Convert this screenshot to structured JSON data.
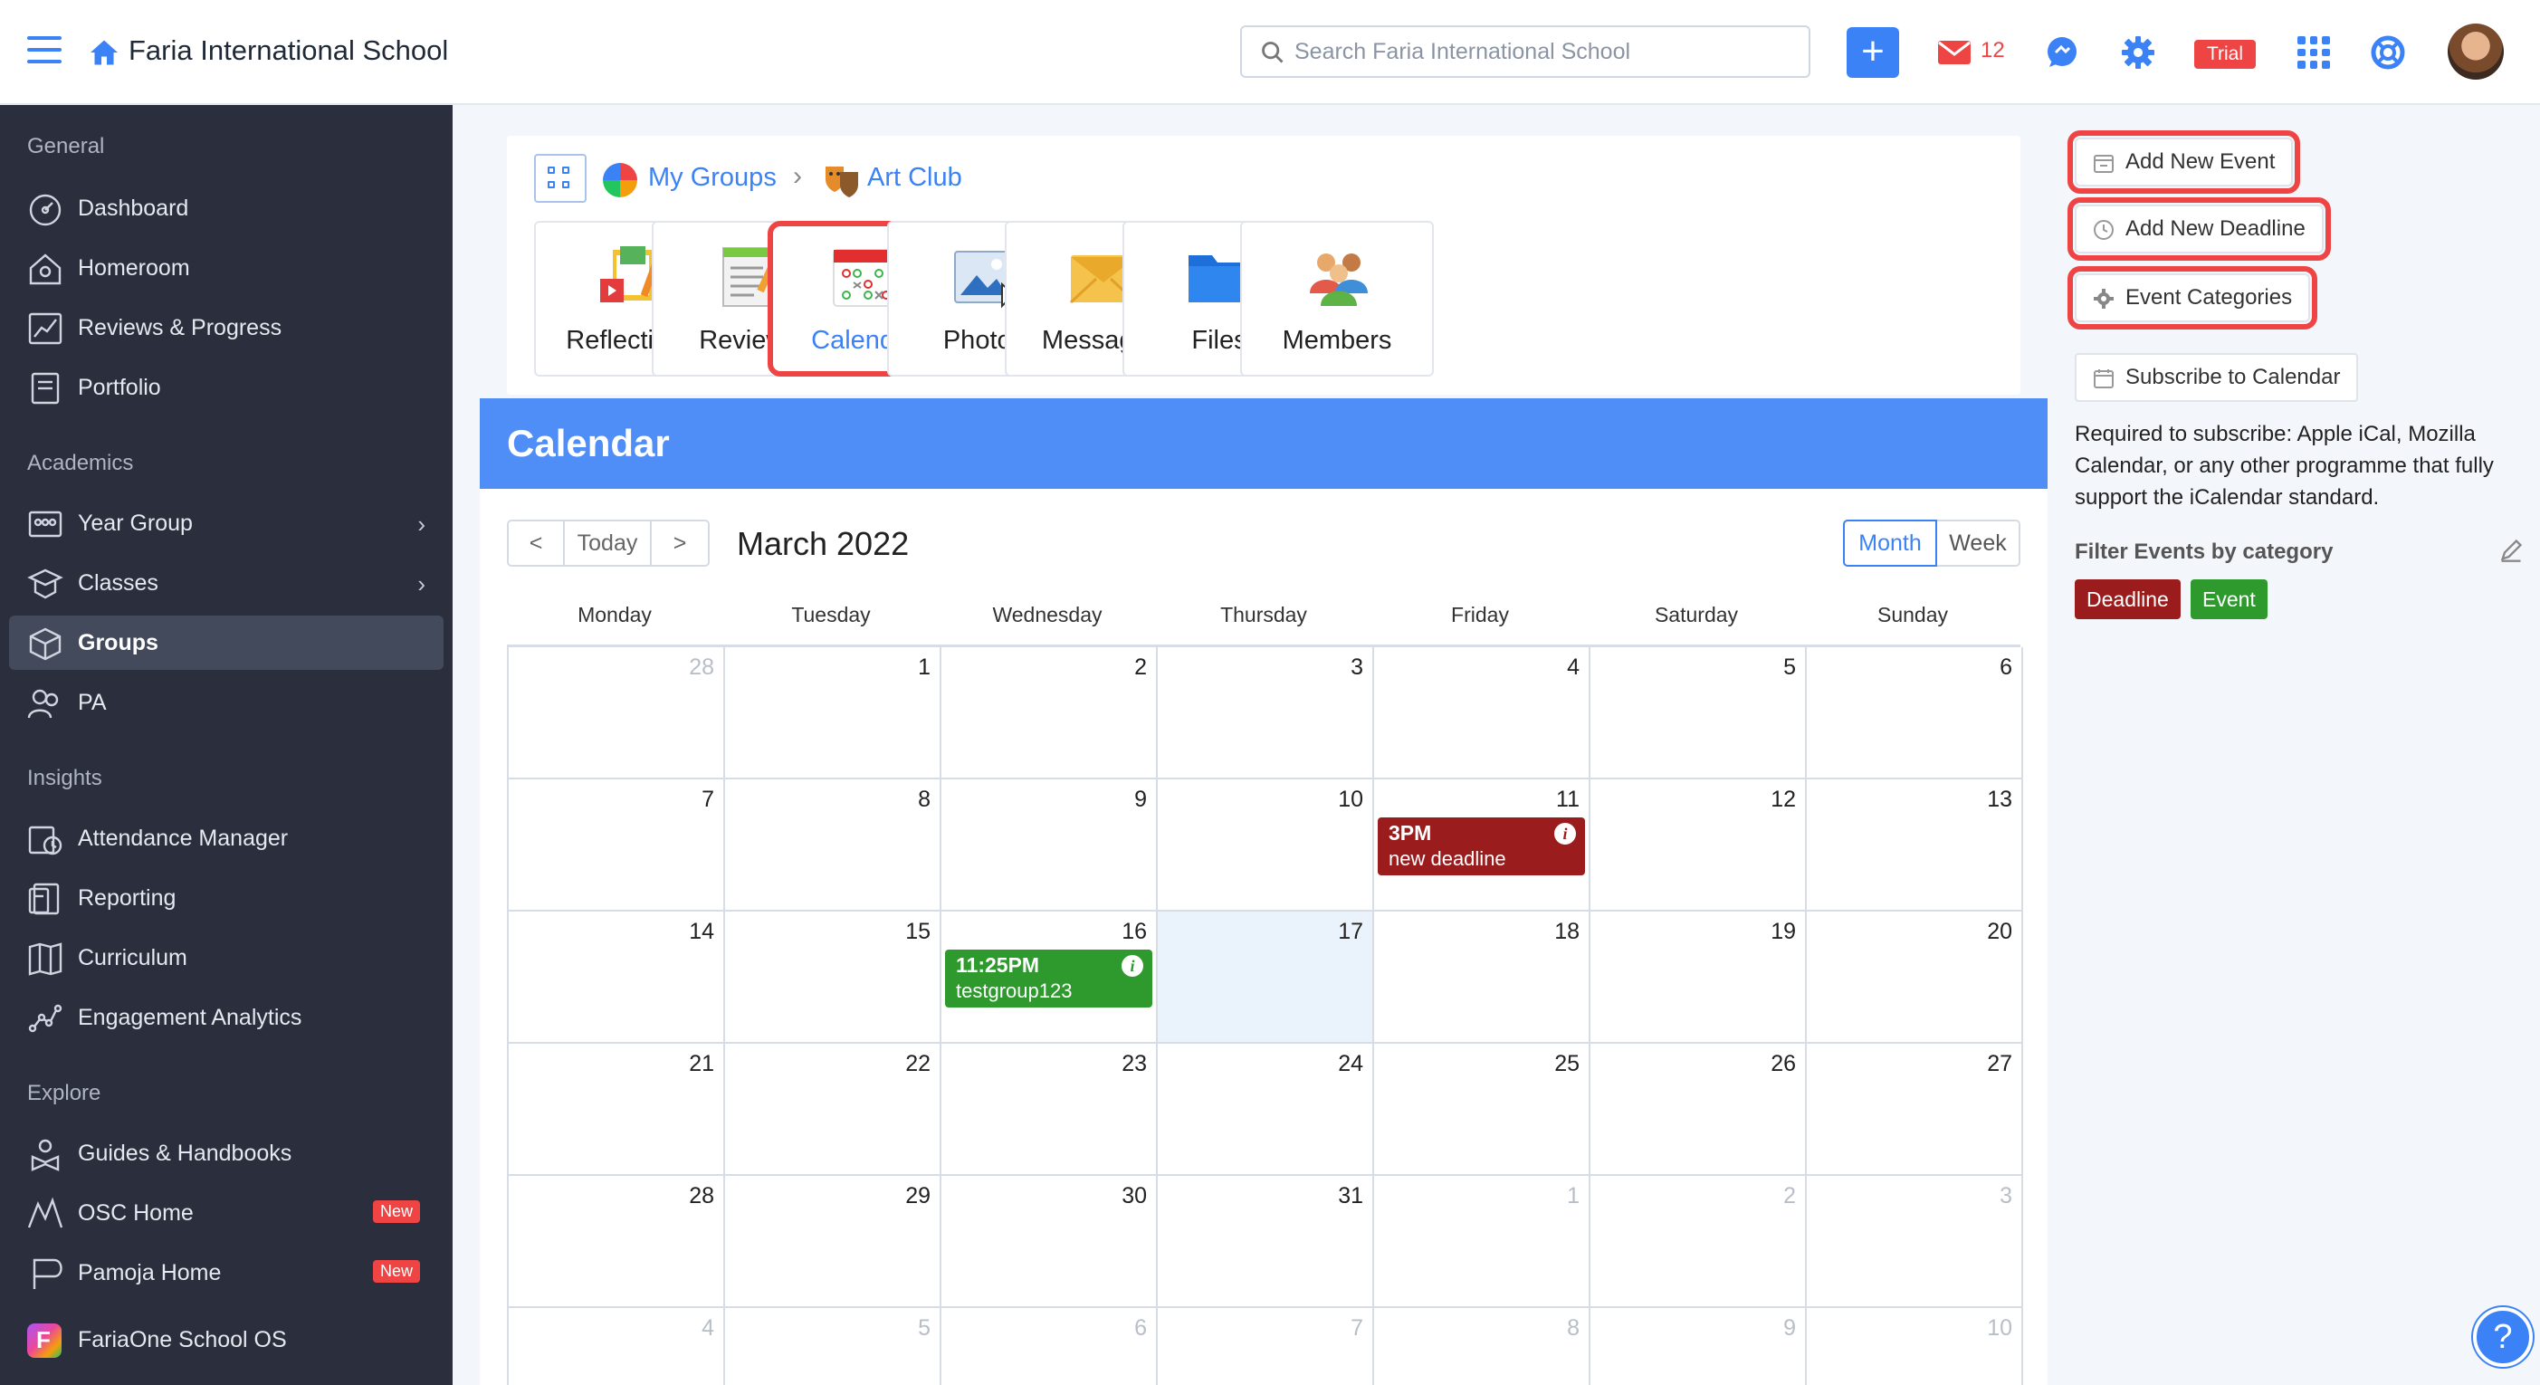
{
  "topbar": {
    "title": "Faria International School",
    "search_placeholder": "Search Faria International School",
    "add_label": "+",
    "mail_count": "12",
    "trial_label": "Trial",
    "brand_color": "#3b82f6"
  },
  "sidebar": {
    "sections": [
      "General",
      "Academics",
      "Insights",
      "Explore"
    ],
    "items": [
      {
        "label": "Dashboard",
        "icon": "dashboard-icon"
      },
      {
        "label": "Homeroom",
        "icon": "homeroom-icon"
      },
      {
        "label": "Reviews & Progress",
        "icon": "chart-icon"
      },
      {
        "label": "Portfolio",
        "icon": "portfolio-icon"
      },
      {
        "label": "Year Group",
        "icon": "year-group-icon"
      },
      {
        "label": "Classes",
        "icon": "classes-icon"
      },
      {
        "label": "Groups",
        "icon": "groups-icon",
        "active": true
      },
      {
        "label": "PA",
        "icon": "pa-icon"
      },
      {
        "label": "Attendance Manager",
        "icon": "attendance-icon"
      },
      {
        "label": "Reporting",
        "icon": "reporting-icon"
      },
      {
        "label": "Curriculum",
        "icon": "curriculum-icon"
      },
      {
        "label": "Engagement Analytics",
        "icon": "analytics-icon"
      },
      {
        "label": "Guides & Handbooks",
        "icon": "guides-icon"
      },
      {
        "label": "OSC Home",
        "icon": "osc-icon",
        "badge": "New"
      },
      {
        "label": "Pamoja Home",
        "icon": "pamoja-icon",
        "badge": "New"
      },
      {
        "label": "FariaOne School OS",
        "icon": "fariaone-icon"
      }
    ]
  },
  "breadcrumb": {
    "my_groups": "My Groups",
    "separator": ">",
    "current": "Art Club"
  },
  "tiles": [
    {
      "label": "Reflections",
      "icon": "reflections-icon"
    },
    {
      "label": "Reviews",
      "icon": "reviews-icon"
    },
    {
      "label": "Calendar",
      "icon": "calendar-icon",
      "selected": true
    },
    {
      "label": "Photos",
      "icon": "photos-icon"
    },
    {
      "label": "Messages",
      "icon": "messages-icon"
    },
    {
      "label": "Files",
      "icon": "files-icon"
    },
    {
      "label": "Members",
      "icon": "members-icon"
    }
  ],
  "calendar": {
    "header": "Calendar",
    "prev": "<",
    "today_label": "Today",
    "next": ">",
    "month_title": "March 2022",
    "views": [
      "Month",
      "Week"
    ],
    "weekdays": [
      "Monday",
      "Tuesday",
      "Wednesday",
      "Thursday",
      "Friday",
      "Saturday",
      "Sunday"
    ],
    "weeks": [
      [
        "28",
        "1",
        "2",
        "3",
        "4",
        "5",
        "6"
      ],
      [
        "7",
        "8",
        "9",
        "10",
        "11",
        "12",
        "13"
      ],
      [
        "14",
        "15",
        "16",
        "17",
        "18",
        "19",
        "20"
      ],
      [
        "21",
        "22",
        "23",
        "24",
        "25",
        "26",
        "27"
      ],
      [
        "28",
        "29",
        "30",
        "31",
        "1",
        "2",
        "3"
      ],
      [
        "4",
        "5",
        "6",
        "7",
        "8",
        "9",
        "10"
      ]
    ],
    "events": [
      {
        "time": "3PM",
        "name": "new deadline",
        "week": 1,
        "day": 4,
        "color": "#9b1c1c"
      },
      {
        "time": "11:25PM",
        "name": "testgroup123",
        "week": 2,
        "day": 2,
        "color": "#2e9a2e"
      }
    ]
  },
  "right_panel": {
    "add_event": "Add New Event",
    "add_deadline": "Add New Deadline",
    "event_categories": "Event Categories",
    "subscribe": "Subscribe to Calendar",
    "subscribe_note": "Required to subscribe: Apple iCal, Mozilla Calendar, or any other programme that fully support the iCalendar standard.",
    "filter_title": "Filter Events by category",
    "categories": [
      {
        "label": "Deadline",
        "color": "#9b1c1c"
      },
      {
        "label": "Event",
        "color": "#2e9a2e"
      }
    ]
  },
  "help_fab": "?"
}
